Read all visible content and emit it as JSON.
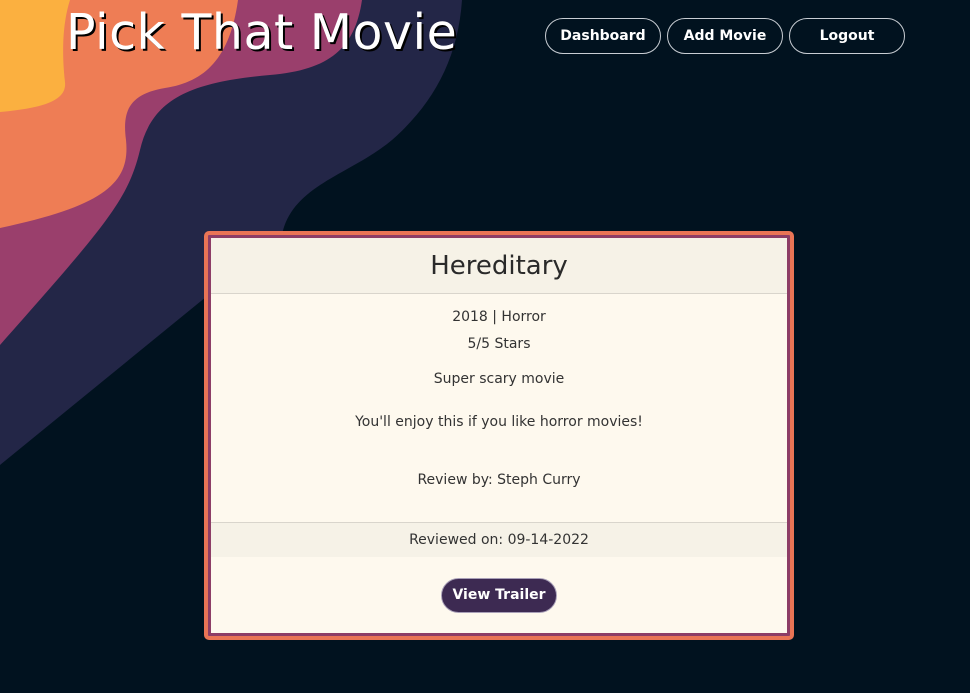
{
  "header": {
    "site_title": "Pick That Movie"
  },
  "nav": {
    "dashboard_label": "Dashboard",
    "add_movie_label": "Add Movie",
    "logout_label": "Logout"
  },
  "movie": {
    "title": "Hereditary",
    "year_genre": "2018 | Horror",
    "rating": "5/5 Stars",
    "summary": "Super scary movie",
    "recommendation": "You'll enjoy this if you like horror movies!",
    "reviewer": "Review by: Steph Curry",
    "reviewed_on": "Reviewed on: 09-14-2022",
    "trailer_label": "View Trailer"
  },
  "colors": {
    "background": "#01121f",
    "wave_yellow": "#fbb040",
    "wave_orange": "#ee7d55",
    "wave_purple": "#9a3f6c",
    "wave_navy": "#232647",
    "card_border": "#e97455",
    "card_background": "#fef9ee",
    "trailer_button": "#3d2a52"
  }
}
